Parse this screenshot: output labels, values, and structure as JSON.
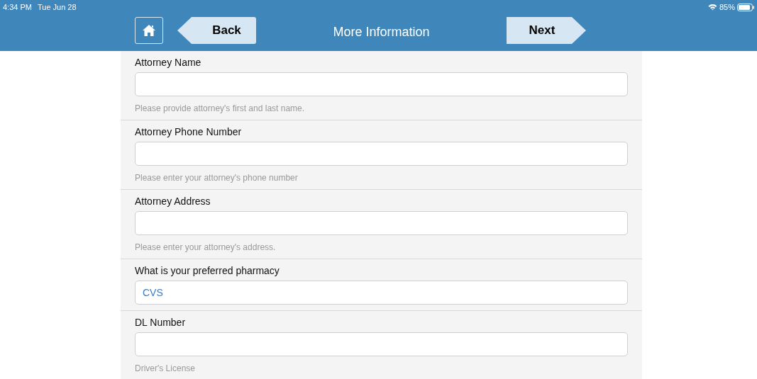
{
  "status_bar": {
    "time": "4:34 PM",
    "date": "Tue Jun 28",
    "battery": "85%"
  },
  "nav": {
    "back": "Back",
    "title": "More Information",
    "next": "Next"
  },
  "fields": [
    {
      "label": "Attorney Name",
      "hint": "Please provide attorney's first and last name."
    },
    {
      "label": "Attorney Phone Number",
      "hint": "Please enter your attorney's phone number"
    },
    {
      "label": "Attorney Address",
      "hint": "Please enter your attorney's address."
    },
    {
      "label": "What is your preferred pharmacy",
      "value": "CVS"
    },
    {
      "label": "DL Number",
      "hint": "Driver's License"
    }
  ]
}
